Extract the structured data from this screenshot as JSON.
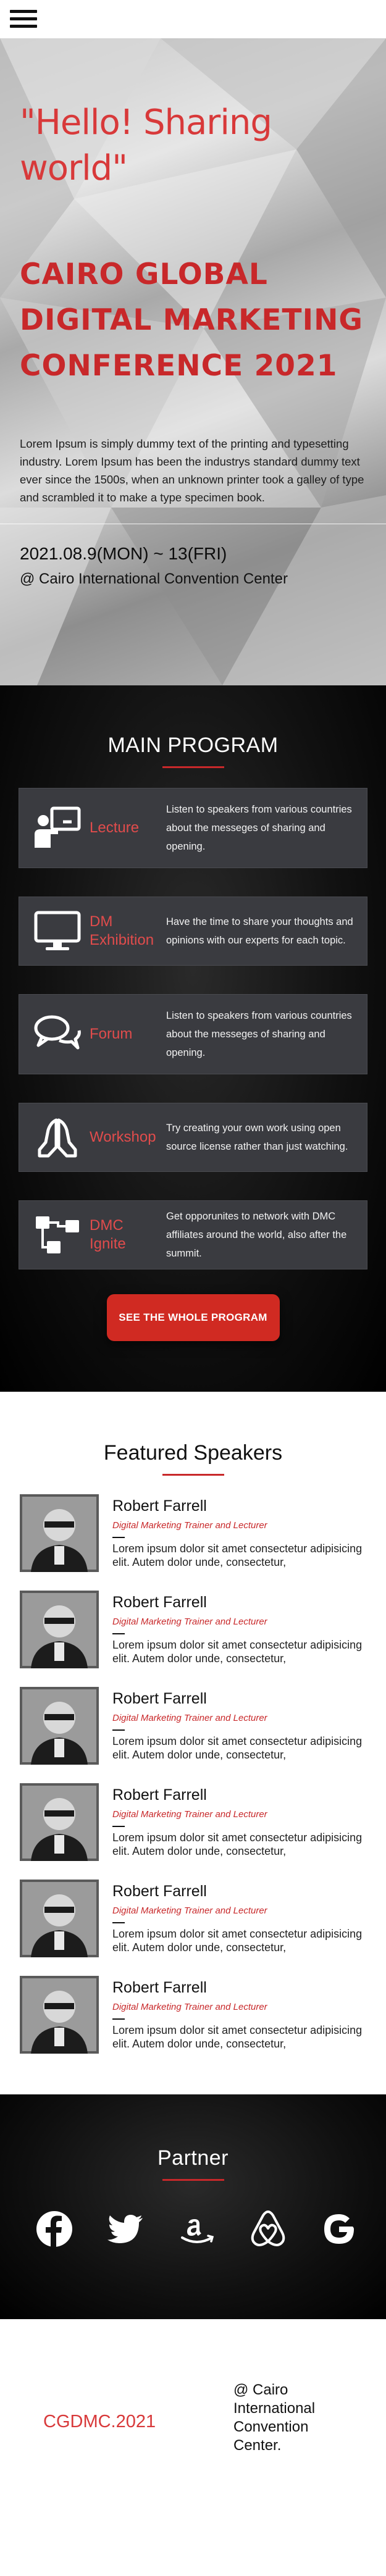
{
  "header": {
    "menu_icon": "hamburger-menu-icon"
  },
  "hero": {
    "greeting": "\"Hello! Sharing world\"",
    "title": "CAIRO GLOBAL DIGITAL MARKETING CONFERENCE 2021",
    "description": "Lorem Ipsum is simply dummy text of the printing and typesetting industry. Lorem Ipsum has been the industrys standard dummy text ever since the 1500s, when an unknown printer took a galley of type and scrambled it to make a type specimen book.",
    "date": "2021.08.9(MON) ~ 13(FRI)",
    "venue": "@ Cairo International Convention Center"
  },
  "program": {
    "title": "MAIN PROGRAM",
    "cards": [
      {
        "icon": "presentation-icon",
        "label": "Lecture",
        "text": "Listen to speakers from various countries about the messeges of sharing and opening."
      },
      {
        "icon": "monitor-icon",
        "label": "DM Exhibition",
        "text": "Have the time to share your thoughts and opinions with our experts for each topic."
      },
      {
        "icon": "chat-bubbles-icon",
        "label": "Forum",
        "text": "Listen to speakers from various countries about the messeges of sharing and opening."
      },
      {
        "icon": "praying-hands-icon",
        "label": "Workshop",
        "text": "Try creating your own work using open source license rather than just watching."
      },
      {
        "icon": "network-nodes-icon",
        "label": "DMC Ignite",
        "text": "Get opporunites to network with DMC affiliates around the world, also after the summit."
      }
    ],
    "button_label": "SEE THE WHOLE PROGRAM"
  },
  "speakers": {
    "title": "Featured Speakers",
    "items": [
      {
        "name": "Robert Farrell",
        "role": "Digital Marketing Trainer and Lecturer",
        "bio": "Lorem ipsum dolor sit amet consectetur adipisicing elit. Autem dolor unde, consectetur,"
      },
      {
        "name": "Robert Farrell",
        "role": "Digital Marketing Trainer and Lecturer",
        "bio": "Lorem ipsum dolor sit amet consectetur adipisicing elit. Autem dolor unde, consectetur,"
      },
      {
        "name": "Robert Farrell",
        "role": "Digital Marketing Trainer and Lecturer",
        "bio": "Lorem ipsum dolor sit amet consectetur adipisicing elit. Autem dolor unde, consectetur,"
      },
      {
        "name": "Robert Farrell",
        "role": "Digital Marketing Trainer and Lecturer",
        "bio": "Lorem ipsum dolor sit amet consectetur adipisicing elit. Autem dolor unde, consectetur,"
      },
      {
        "name": "Robert Farrell",
        "role": "Digital Marketing Trainer and Lecturer",
        "bio": "Lorem ipsum dolor sit amet consectetur adipisicing elit. Autem dolor unde, consectetur,"
      },
      {
        "name": "Robert Farrell",
        "role": "Digital Marketing Trainer and Lecturer",
        "bio": "Lorem ipsum dolor sit amet consectetur adipisicing elit. Autem dolor unde, consectetur,"
      }
    ]
  },
  "partner": {
    "title": "Partner",
    "logos": [
      "facebook-icon",
      "twitter-icon",
      "amazon-icon",
      "airbnb-icon",
      "google-icon"
    ]
  },
  "footer": {
    "brand": "CGDMC.2021",
    "venue": "@ Cairo International Convention Center."
  },
  "colors": {
    "accent": "#c8282a",
    "dark_bg": "#111111",
    "card_bg": "#3a3b40",
    "button": "#d02a22"
  }
}
